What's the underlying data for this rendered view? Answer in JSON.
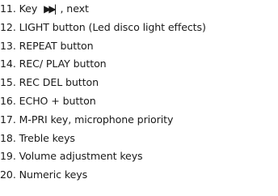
{
  "items": [
    {
      "number": "11.",
      "pre": "Key",
      "icon": "next-track-icon",
      "glyph": "▶▶|",
      "post": ", next"
    },
    {
      "number": "12.",
      "text": "LIGHT button (Led disco light effects)"
    },
    {
      "number": "13.",
      "text": "REPEAT button"
    },
    {
      "number": "14.",
      "text": "REC/ PLAY button"
    },
    {
      "number": "15.",
      "text": "REC DEL button"
    },
    {
      "number": "16.",
      "text": "ECHO + button"
    },
    {
      "number": "17.",
      "text": "M-PRI key, microphone priority"
    },
    {
      "number": "18.",
      "text": "Treble keys"
    },
    {
      "number": "19.",
      "text": "Volume adjustment keys"
    },
    {
      "number": "20.",
      "text": "Numeric keys"
    }
  ]
}
